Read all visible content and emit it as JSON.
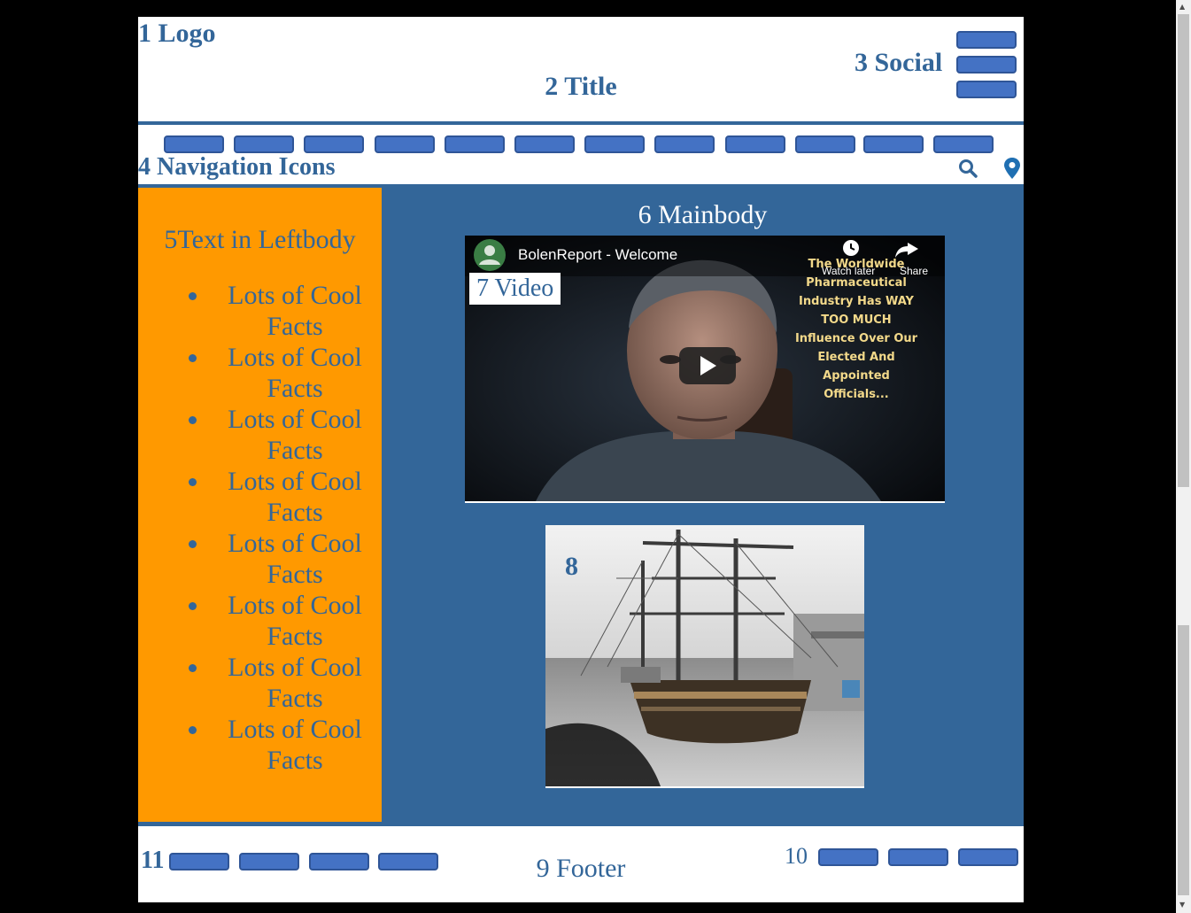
{
  "header": {
    "logo": "1 Logo",
    "title": "2 Title",
    "social_label": "3 Social"
  },
  "nav": {
    "label": "4 Navigation Icons",
    "icons": [
      "search-icon",
      "map-pin-icon"
    ]
  },
  "leftbody": {
    "heading": "5Text in Leftbody",
    "facts": [
      "Lots of Cool Facts",
      "Lots of Cool Facts",
      "Lots of Cool Facts",
      "Lots of Cool Facts",
      "Lots of Cool Facts",
      "Lots of Cool Facts",
      "Lots of Cool Facts",
      "Lots of Cool Facts"
    ]
  },
  "mainbody": {
    "heading": "6 Mainbody",
    "video": {
      "label": "7 Video",
      "channel_title": "BolenReport - Welcome",
      "watch_later": "Watch later",
      "share": "Share",
      "overlay_text": [
        "The Worldwide",
        "Pharmaceutical",
        "Industry Has WAY",
        "TOO MUCH",
        "Influence Over Our",
        "Elected And",
        "Appointed",
        "Officials..."
      ]
    },
    "picture_label": "8"
  },
  "footer": {
    "left_label": "11",
    "center_label": "9 Footer",
    "right_label": "10"
  },
  "colors": {
    "primary": "#336699",
    "leftbody_bg": "#ff9900",
    "button": "#4472c4"
  }
}
